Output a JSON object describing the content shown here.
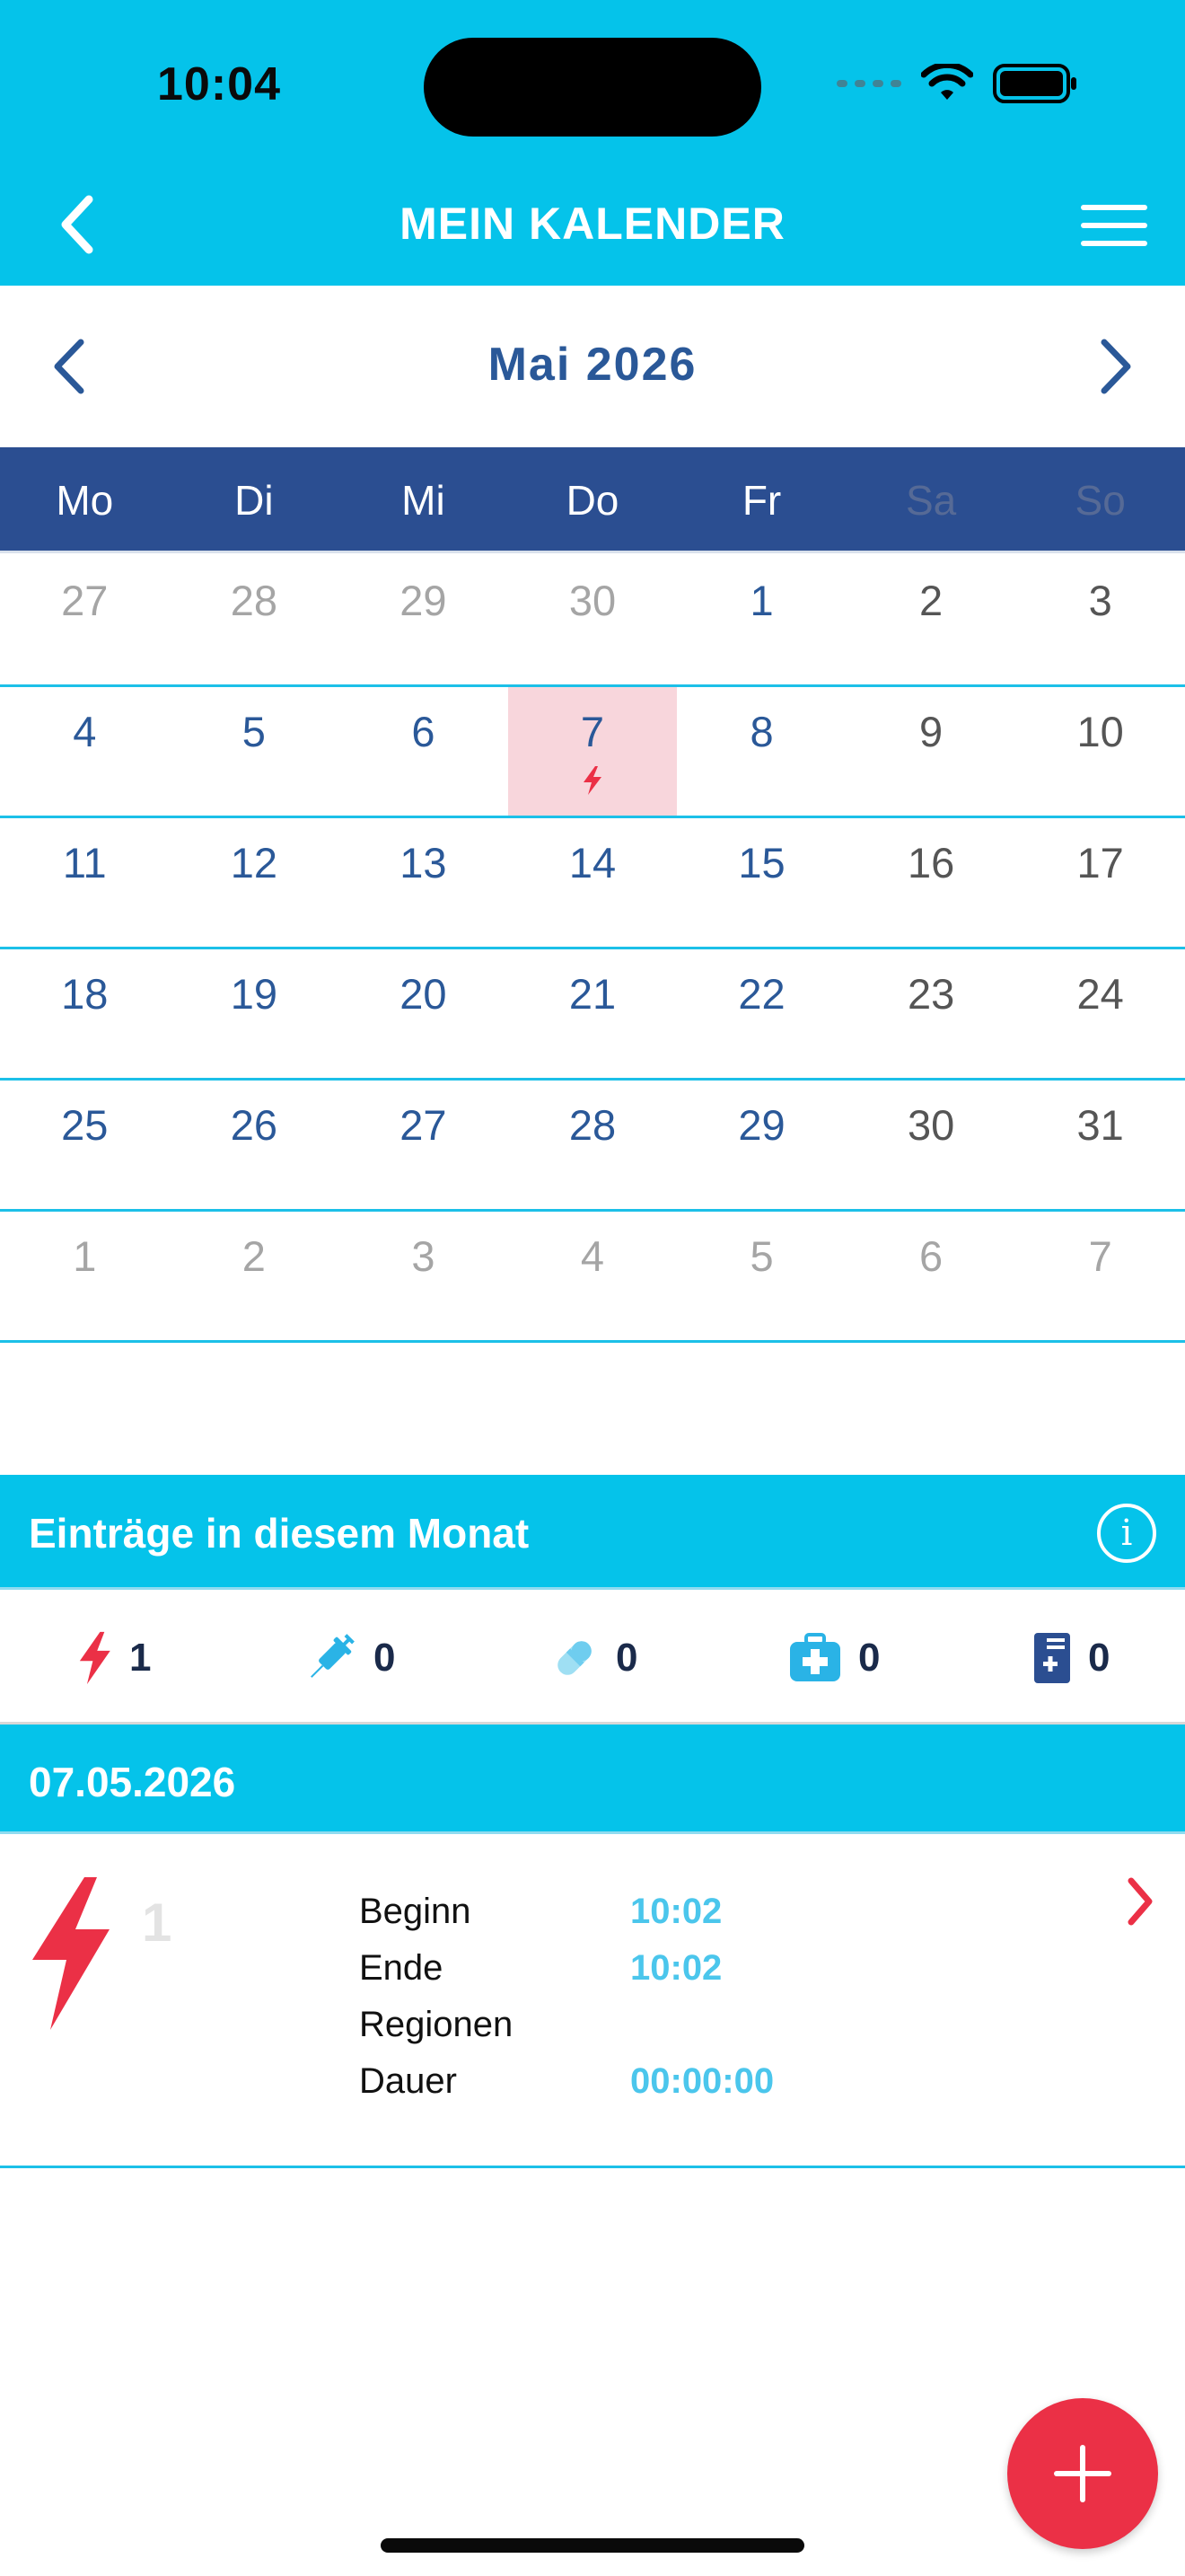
{
  "status_bar": {
    "time": "10:04"
  },
  "nav": {
    "title": "MEIN KALENDER"
  },
  "calendar": {
    "month_label": "Mai 2026",
    "weekdays": [
      "Mo",
      "Di",
      "Mi",
      "Do",
      "Fr",
      "Sa",
      "So"
    ],
    "weeks": [
      [
        "27",
        "28",
        "29",
        "30",
        "1",
        "2",
        "3"
      ],
      [
        "4",
        "5",
        "6",
        "7",
        "8",
        "9",
        "10"
      ],
      [
        "11",
        "12",
        "13",
        "14",
        "15",
        "16",
        "17"
      ],
      [
        "18",
        "19",
        "20",
        "21",
        "22",
        "23",
        "24"
      ],
      [
        "25",
        "26",
        "27",
        "28",
        "29",
        "30",
        "31"
      ],
      [
        "1",
        "2",
        "3",
        "4",
        "5",
        "6",
        "7"
      ]
    ],
    "selected_day": "7"
  },
  "entries": {
    "title": "Einträge in diesem Monat",
    "counters": [
      {
        "icon": "seizure-lightning-icon",
        "count": "1"
      },
      {
        "icon": "syringe-icon",
        "count": "0"
      },
      {
        "icon": "pill-icon",
        "count": "0"
      },
      {
        "icon": "medical-kit-icon",
        "count": "0"
      },
      {
        "icon": "medical-document-icon",
        "count": "0"
      }
    ]
  },
  "day_entry": {
    "date": "07.05.2026",
    "index": "1",
    "rows": [
      {
        "label": "Beginn",
        "value": "10:02"
      },
      {
        "label": "Ende",
        "value": "10:02"
      },
      {
        "label": "Regionen",
        "value": ""
      },
      {
        "label": "Dauer",
        "value": "00:00:00"
      }
    ]
  },
  "colors": {
    "header_cyan": "#05c3ea",
    "weekday_navy": "#2b4e91",
    "day_blue": "#2a5898",
    "accent_red": "#eb3046",
    "selected_pink": "#f8d6dc"
  }
}
